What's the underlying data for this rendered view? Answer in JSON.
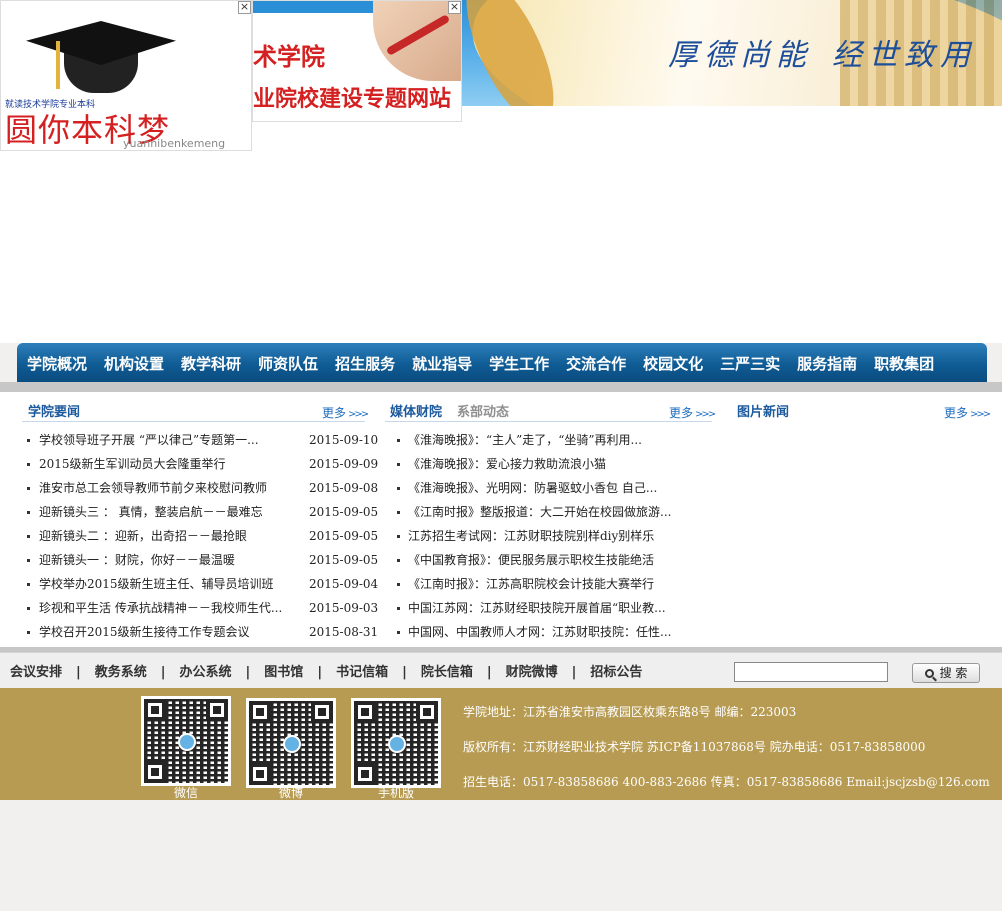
{
  "ads": {
    "ad1": {
      "subtitle": "就读技术学院专业本科",
      "title": "圆你本科梦",
      "pinyin": "yuannibenkemeng",
      "close": "×"
    },
    "ad2": {
      "line1": "术学院",
      "line2": "业院校建设专题网站",
      "close": "×"
    }
  },
  "header": {
    "motto_part1": "厚德尚能",
    "motto_part2": "经世致用"
  },
  "nav": {
    "items": [
      "学院概况",
      "机构设置",
      "教学科研",
      "师资队伍",
      "招生服务",
      "就业指导",
      "学生工作",
      "交流合作",
      "校园文化",
      "三严三实",
      "服务指南",
      "职教集团"
    ]
  },
  "news": {
    "title": "学院要闻",
    "more": "更多",
    "items": [
      {
        "title": "学校领导班子开展 “严以律己”专题第一...",
        "date": "2015-09-10"
      },
      {
        "title": "2015级新生军训动员大会隆重举行",
        "date": "2015-09-09"
      },
      {
        "title": "淮安市总工会领导教师节前夕来校慰问教师",
        "date": "2015-09-08"
      },
      {
        "title": "迎新镜头三 ： 真情，整装启航－－最难忘",
        "date": "2015-09-05"
      },
      {
        "title": "迎新镜头二 ：迎新，出奇招－－最抢眼",
        "date": "2015-09-05"
      },
      {
        "title": "迎新镜头一 ：财院，你好－－最温暖",
        "date": "2015-09-05"
      },
      {
        "title": "学校举办2015级新生班主任、辅导员培训班",
        "date": "2015-09-04"
      },
      {
        "title": "珍视和平生活 传承抗战精神－－我校师生代...",
        "date": "2015-09-03"
      },
      {
        "title": "学校召开2015级新生接待工作专题会议",
        "date": "2015-08-31"
      }
    ]
  },
  "media": {
    "title": "媒体财院",
    "tab2": "系部动态",
    "more": "更多",
    "items": [
      "《淮海晚报》：“主人”走了，“坐骑”再利用...",
      "《淮海晚报》：爱心接力救助流浪小猫",
      "《淮海晚报》、光明网：防暑驱蚊小香包 自己...",
      "《江南时报》整版报道：大二开始在校园做旅游...",
      "江苏招生考试网：江苏财职技院别样diy别样乐",
      "《中国教育报》：便民服务展示职校生技能绝活",
      "《江南时报》：江苏高职院校会计技能大赛举行",
      "中国江苏网：江苏财经职技院开展首届“职业教...",
      "中国网、中国教师人才网：江苏财职技院：任性..."
    ]
  },
  "photos": {
    "title": "图片新闻",
    "more": "更多"
  },
  "links": {
    "items": [
      "会议安排",
      "教务系统",
      "办公系统",
      "图书馆",
      "书记信箱",
      "院长信箱",
      "财院微博",
      "招标公告"
    ],
    "search_button": "搜 索",
    "search_value": ""
  },
  "footer": {
    "qr_labels": [
      "微信",
      "微博",
      "手机版"
    ],
    "address": "学院地址：江苏省淮安市高教园区枚乘东路8号 邮编：223003",
    "copyright": "版权所有：江苏财经职业技术学院 苏ICP备11037868号 院办电话：0517-83858000",
    "contact": "招生电话：0517-83858686 400-883-2686 传真：0517-83858686 Email:jscjzsb@126.com"
  }
}
